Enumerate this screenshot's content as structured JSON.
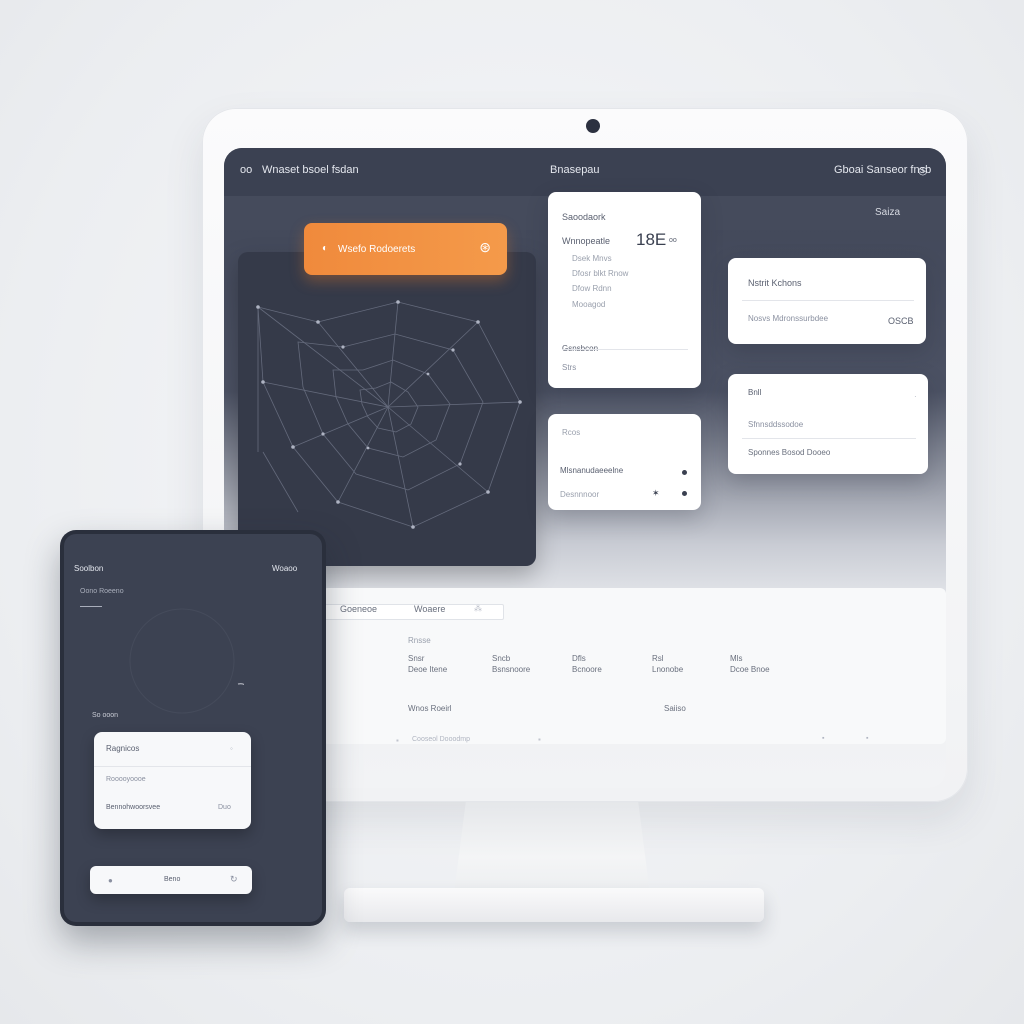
{
  "monitor": {
    "topbar": {
      "left_icon": "oo",
      "left_title": "Wnaset bsoel fsdan",
      "center_title": "Bnasepau",
      "right_text": "Gboai Sanseor fnsb",
      "right_icon": "◷"
    },
    "settings_link": "Saiza",
    "orange_button": {
      "label": "Wsefo Rodoerets",
      "left_icon": "◐",
      "right_icon": "⊛"
    },
    "card_stats": {
      "title": "Saoodaork",
      "label": "Wnnopeatle",
      "value": "18E",
      "unit": "oo",
      "items": [
        "Dsek Mnvs",
        "Dfosr blkt Rnow",
        "Dfow Rdnn",
        "Mooagod"
      ],
      "footer_label": "Gsnsbcon",
      "footer_value": "Strs"
    },
    "card_mid": {
      "label": "Rcos",
      "rows": [
        "Mlsnanudaeeelne",
        "Desnnnoor"
      ]
    },
    "card_right_top": {
      "title": "Nstrit Kchons",
      "row_label": "Nosvs Mdronssurbdee",
      "row_value": "OSCB"
    },
    "card_right_bottom": {
      "title": "Bnll",
      "rows": [
        "Sfnnsddssodoe",
        "Sponnes Bosod Dooeo"
      ]
    },
    "bottom_panel": {
      "tabs": [
        "Goeneoe",
        "Woaere"
      ],
      "section_label": "Rnsse",
      "columns": [
        {
          "top": "Snsr",
          "bottom": "Deoe Itene"
        },
        {
          "top": "Sncb",
          "bottom": "Bsnsnoore"
        },
        {
          "top": "Dfls",
          "bottom": "Bcnoore"
        },
        {
          "top": "Rsl",
          "bottom": "Lnonobe"
        },
        {
          "top": "Mls",
          "bottom": "Dcoe Bnoe"
        }
      ],
      "footer_left_title": "Wnos Roeirl",
      "footer_left_sub": "Cooseol Dooodmp",
      "footer_right_title": "Saiiso"
    }
  },
  "tablet": {
    "title": "Soolbon",
    "top_right": "Woaoo",
    "subtitle": "Oono Roeeno",
    "section_label": "So ooon",
    "card": {
      "title": "Ragnicos",
      "rows": [
        "Rooooyoooe",
        "Bennohwoorsvee"
      ],
      "row_value": "Duo"
    },
    "bottom_button": "Beno"
  },
  "colors": {
    "accent_orange": "#f08a3c",
    "dark_panel": "#353a49",
    "screen_bar": "#3b4152"
  }
}
